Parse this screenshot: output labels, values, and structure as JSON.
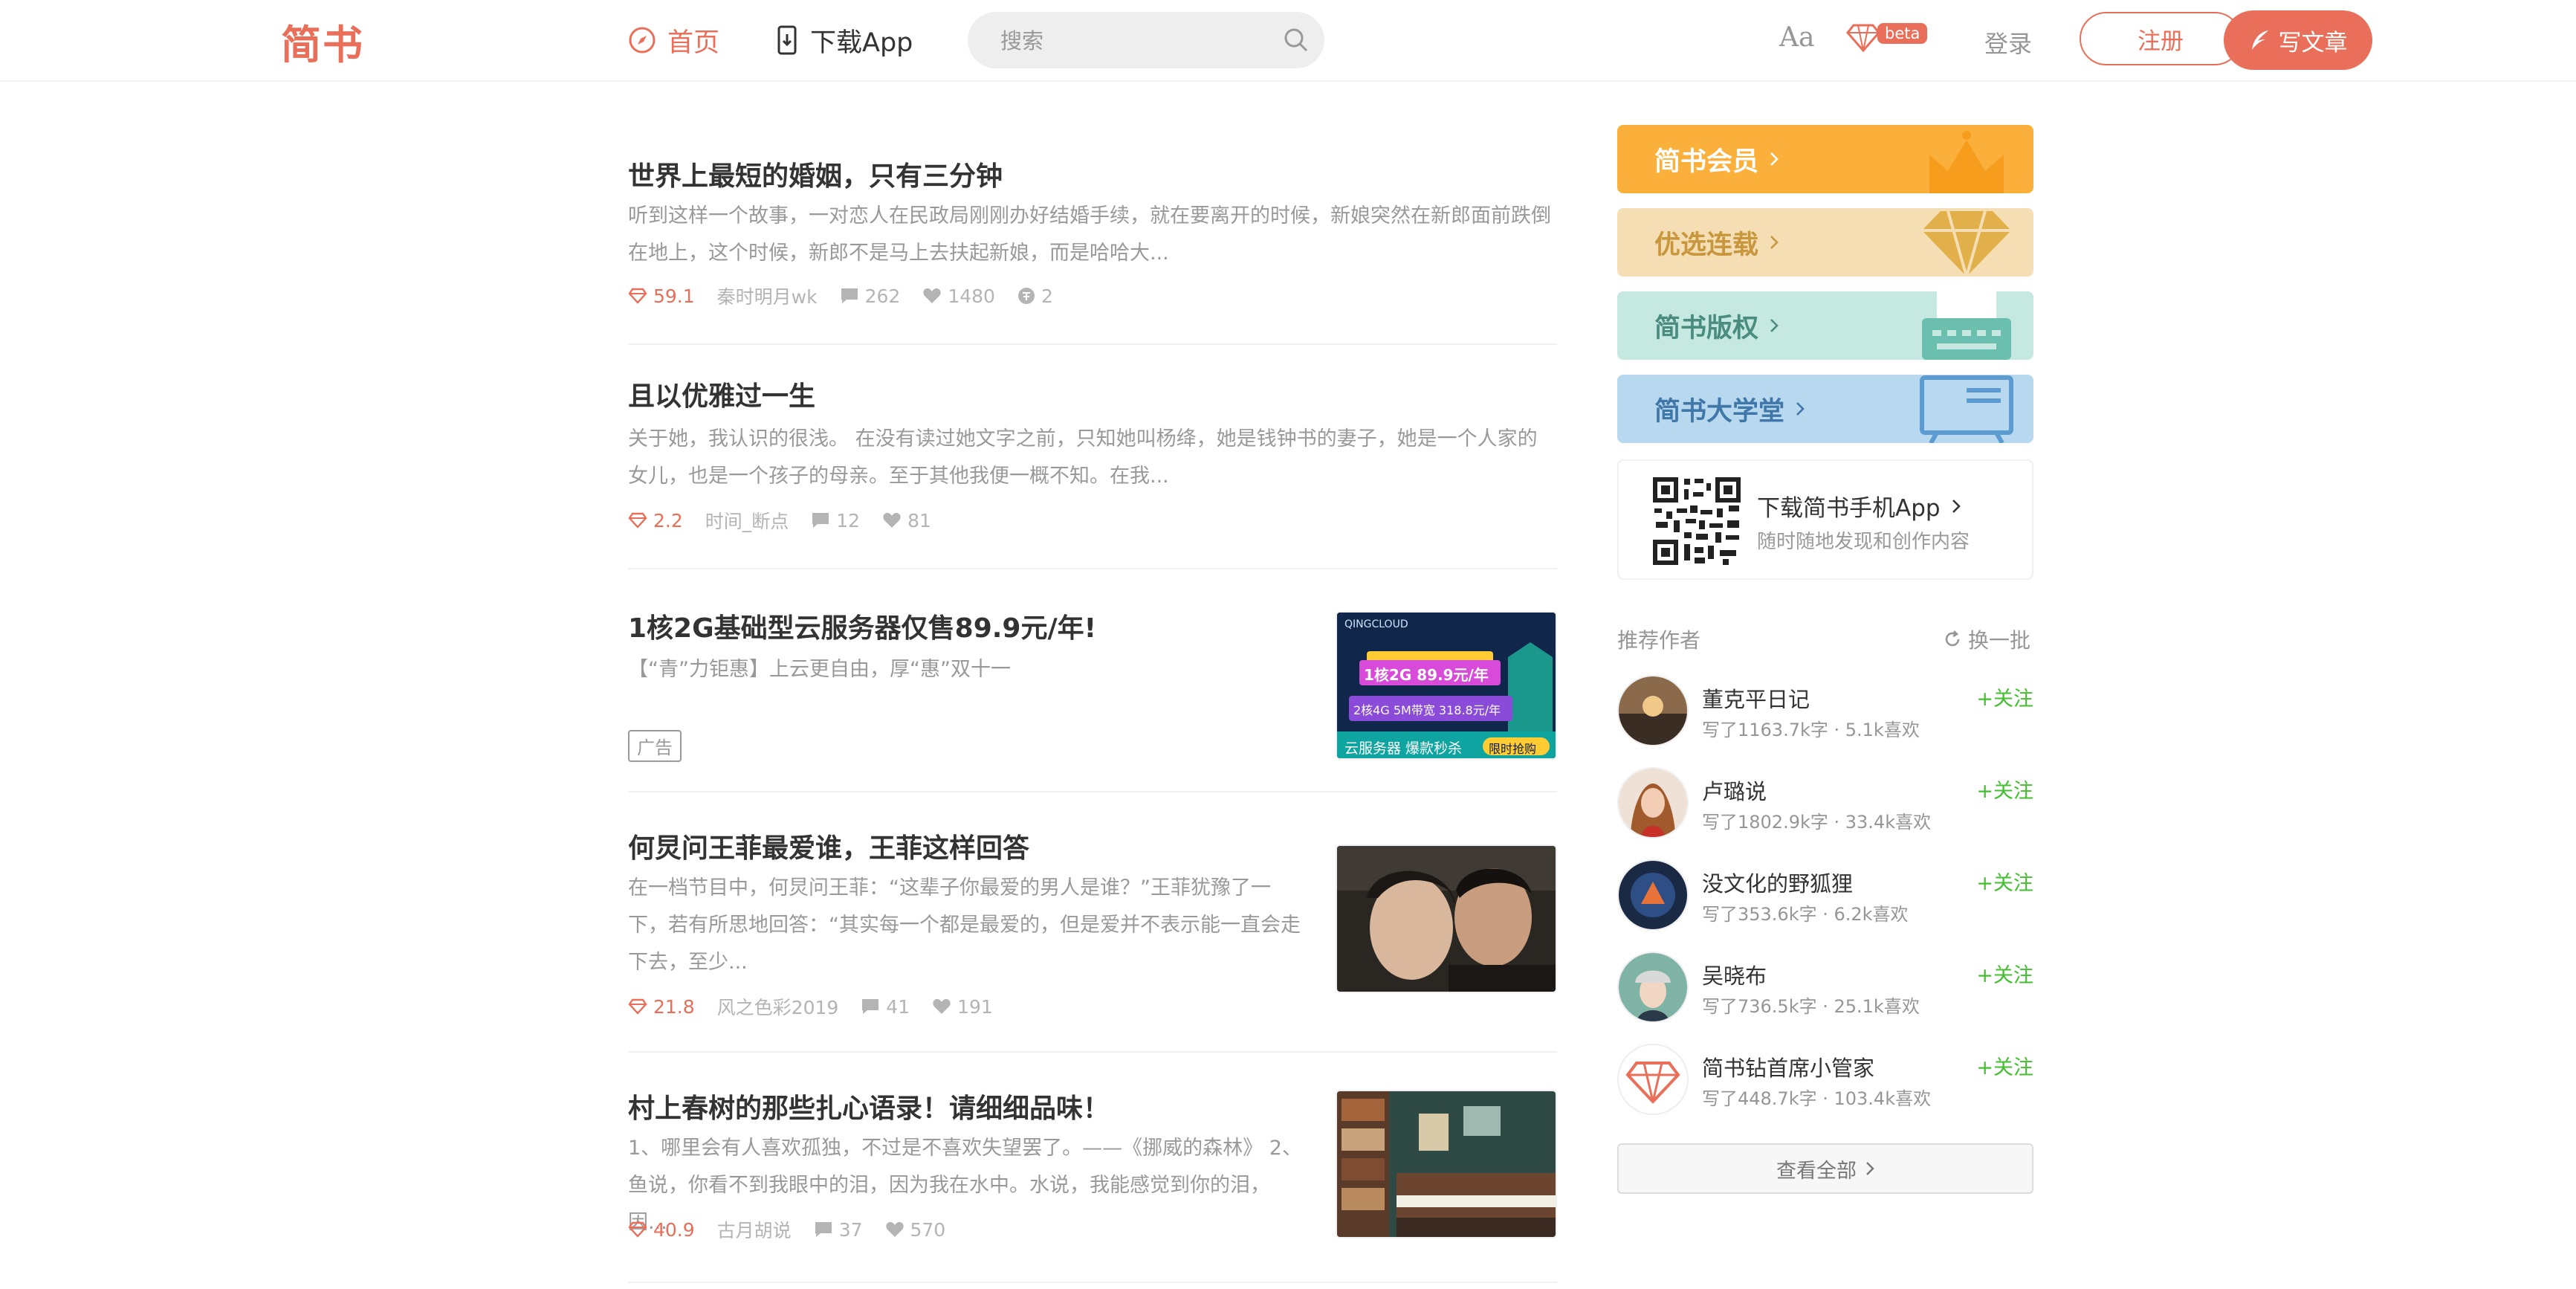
{
  "header": {
    "logo": "简书",
    "nav": {
      "home": "首页",
      "app": "下载App"
    },
    "search_placeholder": "搜索",
    "aa_label": "Aa",
    "beta_label": "beta",
    "login": "登录",
    "register": "注册",
    "write": "写文章"
  },
  "colors": {
    "accent": "#ea6f5a",
    "follow": "#42c02e",
    "meta": "#b4b4b4"
  },
  "articles": [
    {
      "title": "世界上最短的婚姻，只有三分钟",
      "abstract": "听到这样一个故事，一对恋人在民政局刚刚办好结婚手续，就在要离开的时候，新娘突然在新郎面前跌倒在地上，这个时候，新郎不是马上去扶起新娘，而是哈哈大...",
      "score": "59.1",
      "author": "秦时明月wk",
      "comments": "262",
      "likes": "1480",
      "rewards": "2"
    },
    {
      "title": "且以优雅过一生",
      "abstract": "关于她，我认识的很浅。 在没有读过她文字之前，只知她叫杨绛，她是钱钟书的妻子，她是一个人家的女儿，也是一个孩子的母亲。至于其他我便一概不知。在我...",
      "score": "2.2",
      "author": "时间_断点",
      "comments": "12",
      "likes": "81"
    },
    {
      "title": "1核2G基础型云服务器仅售89.9元/年!",
      "abstract": "【“青”力钜惠】上云更自由，厚“惠”双十一",
      "ad_tag": "广告",
      "ad_text": {
        "brand": "QINGCLOUD",
        "line1": "1核2G  89.9元/年",
        "line2": "2核4G  5M带宽  318.8元/年",
        "bottom": "云服务器  爆款秒杀",
        "cta": "限时抢购"
      }
    },
    {
      "title": "何炅问王菲最爱谁，王菲这样回答",
      "abstract": "在一档节目中，何炅问王菲：“这辈子你最爱的男人是谁？”王菲犹豫了一下，若有所思地回答：“其实每一个都是最爱的，但是爱并不表示能一直会走下去，至少...",
      "score": "21.8",
      "author": "风之色彩2019",
      "comments": "41",
      "likes": "191"
    },
    {
      "title": "村上春树的那些扎心语录！请细细品味！",
      "abstract": "1、哪里会有人喜欢孤独，不过是不喜欢失望罢了。——《挪威的森林》 2、鱼说，你看不到我眼中的泪，因为我在水中。水说，我能感觉到你的泪，因...",
      "score": "40.9",
      "author": "古月胡说",
      "comments": "37",
      "likes": "570"
    }
  ],
  "sidebar": {
    "banners": [
      {
        "label": "简书会员",
        "bg": "#fbb03b",
        "fg": "#ffffff"
      },
      {
        "label": "优选连载",
        "bg": "#f5deb3",
        "fg": "#c8963c"
      },
      {
        "label": "简书版权",
        "bg": "#c5e8e1",
        "fg": "#4a8c80"
      },
      {
        "label": "简书大学堂",
        "bg": "#b8d8ef",
        "fg": "#3f78a8"
      }
    ],
    "app": {
      "title": "下载简书手机App",
      "subtitle": "随时随地发现和创作内容"
    },
    "rec_title": "推荐作者",
    "refresh": "换一批",
    "follow": "+关注",
    "authors": [
      {
        "name": "董克平日记",
        "info": "写了1163.7k字 · 5.1k喜欢"
      },
      {
        "name": "卢璐说",
        "info": "写了1802.9k字 · 33.4k喜欢"
      },
      {
        "name": "没文化的野狐狸",
        "info": "写了353.6k字 · 6.2k喜欢"
      },
      {
        "name": "吴晓布",
        "info": "写了736.5k字 · 25.1k喜欢"
      },
      {
        "name": "简书钻首席小管家",
        "info": "写了448.7k字 · 103.4k喜欢"
      }
    ],
    "see_all": "查看全部"
  }
}
